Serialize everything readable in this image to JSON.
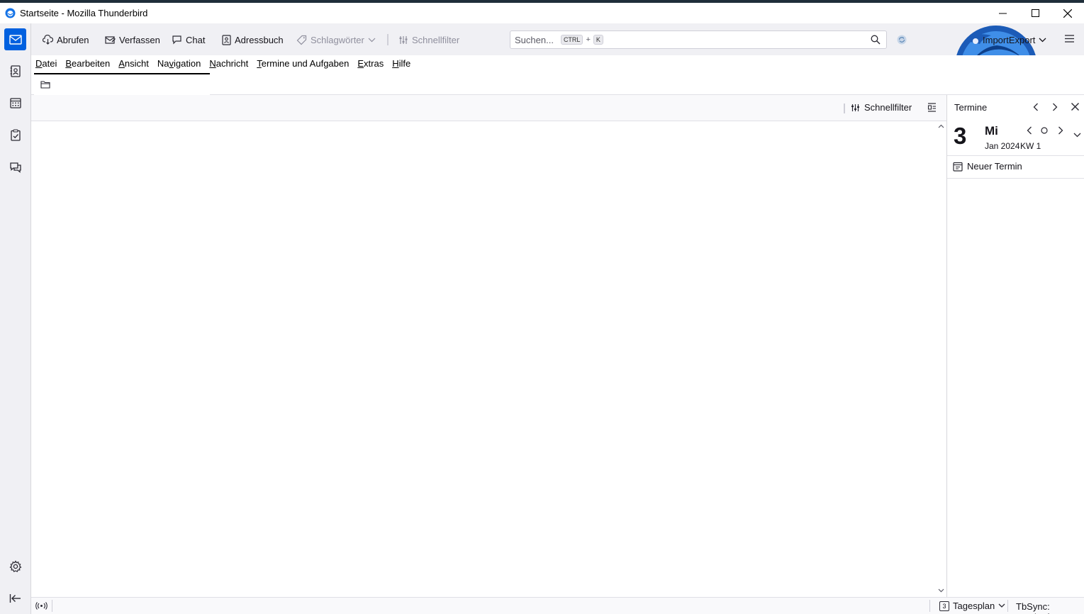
{
  "window": {
    "title": "Startseite - Mozilla Thunderbird"
  },
  "spaces": [
    {
      "name": "mail",
      "active": true
    },
    {
      "name": "address-book"
    },
    {
      "name": "calendar"
    },
    {
      "name": "tasks"
    },
    {
      "name": "chat"
    }
  ],
  "toolbar": {
    "get_messages": "Abrufen",
    "write": "Verfassen",
    "chat": "Chat",
    "address_book": "Adressbuch",
    "tags": "Schlagwörter",
    "quick_filter": "Schnellfilter",
    "search_placeholder": "Suchen...",
    "search_shortcut_key1": "CTRL",
    "search_shortcut_plus": "+",
    "search_shortcut_key2": "K",
    "import_export": "ImportExport"
  },
  "menu": {
    "items": [
      {
        "pre": "",
        "acc": "D",
        "post": "atei"
      },
      {
        "pre": "",
        "acc": "B",
        "post": "earbeiten"
      },
      {
        "pre": "",
        "acc": "A",
        "post": "nsicht"
      },
      {
        "pre": "Na",
        "acc": "v",
        "post": "igation"
      },
      {
        "pre": "",
        "acc": "N",
        "post": "achricht"
      },
      {
        "pre": "",
        "acc": "T",
        "post": "ermine und Aufgaben"
      },
      {
        "pre": "",
        "acc": "E",
        "post": "xtras"
      },
      {
        "pre": "",
        "acc": "H",
        "post": "ilfe"
      }
    ]
  },
  "pane": {
    "quick_filter": "Schnellfilter"
  },
  "today_pane": {
    "title": "Termine",
    "day_number": "3",
    "weekday": "Mi",
    "month_year": "Jan 2024",
    "week": "KW 1",
    "new_event": "Neuer Termin"
  },
  "status": {
    "day_badge": "3",
    "view": "Tagesplan",
    "tbsync": "TbSync: Leerlauf"
  },
  "colors": {
    "accent": "#0060df",
    "toolbar_bg": "#f0f0f4"
  }
}
